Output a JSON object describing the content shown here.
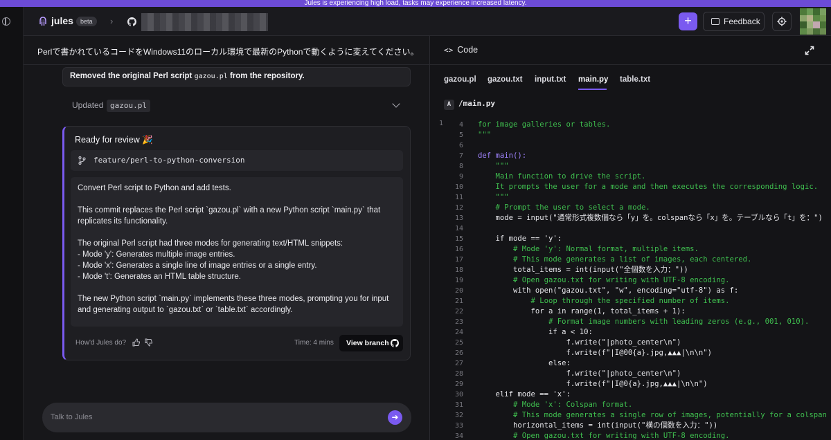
{
  "banner": {
    "text": "Jules is experiencing high load, tasks may experience increased latency."
  },
  "header": {
    "app_name": "jules",
    "badge": "beta",
    "feedback_label": "Feedback",
    "plus_label": "+"
  },
  "task": {
    "title": "Perlで書かれているコードをWindows11のローカル環境で最新のPythonで動くように変えてください。",
    "removed_prefix": "Removed the original Perl script ",
    "removed_file": "gazou.pl",
    "removed_suffix": " from the repository.",
    "updated_label": "Updated",
    "updated_file": "gazou.pl"
  },
  "review": {
    "title": "Ready for review 🎉",
    "branch": "feature/perl-to-python-conversion",
    "commit_paragraphs": [
      "Convert Perl script to Python and add tests.",
      "This commit replaces the Perl script `gazou.pl` with a new Python script `main.py` that replicates its functionality.",
      "The original Perl script had three modes for generating text/HTML snippets:\n- Mode 'y': Generates multiple image entries.\n- Mode 'x': Generates a single line of image entries or a single entry.\n- Mode 't': Generates an HTML table structure.",
      "The new Python script `main.py` implements these three modes, prompting you for input and generating output to `gazou.txt` or `table.txt` accordingly."
    ],
    "rate_prompt": "How'd Jules do?",
    "time": "Time: 4 mins",
    "view_branch_label": "View branch"
  },
  "composer": {
    "placeholder": "Talk to Jules"
  },
  "code_panel": {
    "title": "Code",
    "tabs": [
      "gazou.pl",
      "gazou.txt",
      "input.txt",
      "main.py",
      "table.txt"
    ],
    "active_tab": "main.py",
    "file_badge": "A",
    "file_path": "/main.py",
    "first_gutter": "1",
    "lines": [
      {
        "n": "4",
        "t": "for image galleries or tables.",
        "c": "c-str"
      },
      {
        "n": "5",
        "t": "\"\"\"",
        "c": "c-str"
      },
      {
        "n": "6",
        "t": "",
        "c": "c-plain"
      },
      {
        "n": "7",
        "t": "def main():",
        "c": "c-kw"
      },
      {
        "n": "8",
        "t": "    \"\"\"",
        "c": "c-str"
      },
      {
        "n": "9",
        "t": "    Main function to drive the script.",
        "c": "c-str"
      },
      {
        "n": "10",
        "t": "    It prompts the user for a mode and then executes the corresponding logic.",
        "c": "c-str"
      },
      {
        "n": "11",
        "t": "    \"\"\"",
        "c": "c-str"
      },
      {
        "n": "12",
        "t": "    # Prompt the user to select a mode.",
        "c": "c-comment"
      },
      {
        "n": "13",
        "t": "    mode = input(\"通常形式複数個なら「y」を。colspanなら「x」を。テーブルなら「t」を：\")",
        "c": "c-plain"
      },
      {
        "n": "14",
        "t": "",
        "c": "c-plain"
      },
      {
        "n": "15",
        "t": "    if mode == 'y':",
        "c": "c-plain"
      },
      {
        "n": "16",
        "t": "        # Mode 'y': Normal format, multiple items.",
        "c": "c-comment"
      },
      {
        "n": "17",
        "t": "        # This mode generates a list of images, each centered.",
        "c": "c-comment"
      },
      {
        "n": "18",
        "t": "        total_items = int(input(\"全個数を入力：\"))",
        "c": "c-plain"
      },
      {
        "n": "19",
        "t": "        # Open gazou.txt for writing with UTF-8 encoding.",
        "c": "c-comment"
      },
      {
        "n": "20",
        "t": "        with open(\"gazou.txt\", \"w\", encoding=\"utf-8\") as f:",
        "c": "c-plain"
      },
      {
        "n": "21",
        "t": "            # Loop through the specified number of items.",
        "c": "c-comment"
      },
      {
        "n": "22",
        "t": "            for a in range(1, total_items + 1):",
        "c": "c-plain"
      },
      {
        "n": "23",
        "t": "                # Format image numbers with leading zeros (e.g., 001, 010).",
        "c": "c-comment"
      },
      {
        "n": "24",
        "t": "                if a < 10:",
        "c": "c-plain"
      },
      {
        "n": "25",
        "t": "                    f.write(\"|photo_center\\n\")",
        "c": "c-plain"
      },
      {
        "n": "26",
        "t": "                    f.write(f\"|I@00{a}.jpg,▲▲▲|\\n\\n\")",
        "c": "c-plain"
      },
      {
        "n": "27",
        "t": "                else:",
        "c": "c-plain"
      },
      {
        "n": "28",
        "t": "                    f.write(\"|photo_center\\n\")",
        "c": "c-plain"
      },
      {
        "n": "29",
        "t": "                    f.write(f\"|I@0{a}.jpg,▲▲▲|\\n\\n\")",
        "c": "c-plain"
      },
      {
        "n": "30",
        "t": "    elif mode == 'x':",
        "c": "c-plain"
      },
      {
        "n": "31",
        "t": "        # Mode 'x': Colspan format.",
        "c": "c-comment"
      },
      {
        "n": "32",
        "t": "        # This mode generates a single row of images, potentially for a colspan",
        "c": "c-comment"
      },
      {
        "n": "33",
        "t": "        horizontal_items = int(input(\"横の個数を入力：\"))",
        "c": "c-plain"
      },
      {
        "n": "34",
        "t": "        # Open gazou.txt for writing with UTF-8 encoding.",
        "c": "c-comment"
      }
    ]
  },
  "colors": {
    "accent": "#7a5af0",
    "banner": "#6c4bd6"
  },
  "icons": [
    "panel-toggle-icon",
    "jules-logo-icon",
    "github-icon",
    "feedback-icon",
    "gear-icon",
    "branch-icon",
    "thumbs-up-icon",
    "thumbs-down-icon",
    "send-arrow-icon",
    "code-brackets-icon",
    "expand-icon",
    "chevron-down-icon"
  ]
}
